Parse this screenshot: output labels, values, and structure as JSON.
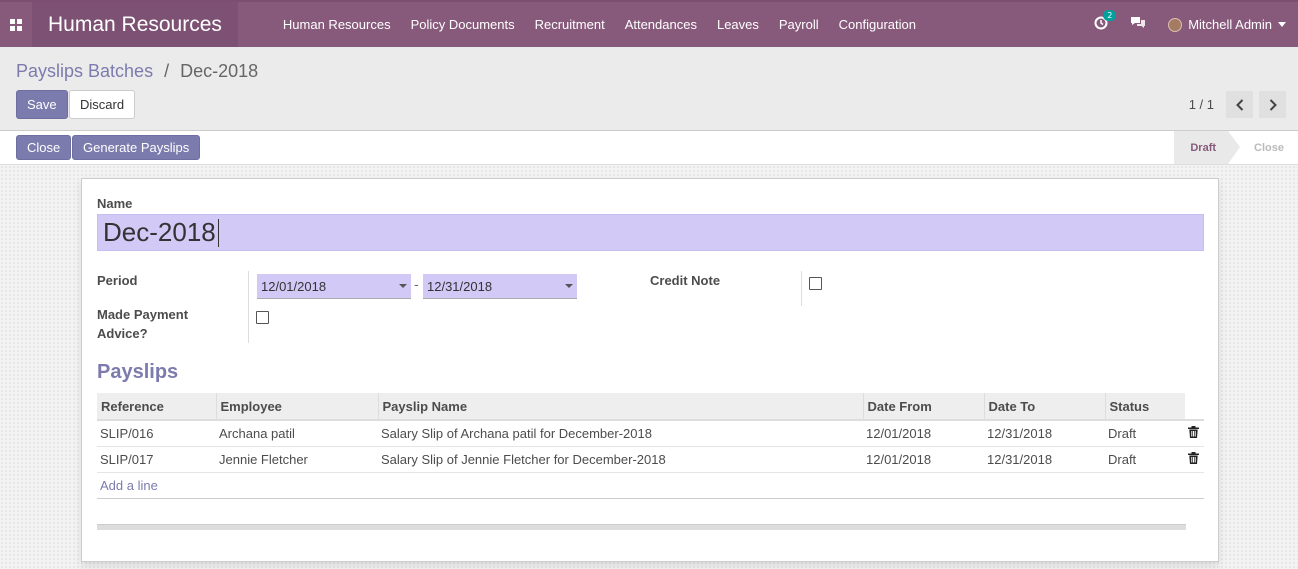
{
  "navbar": {
    "app_title": "Human Resources",
    "menu": [
      "Human Resources",
      "Policy Documents",
      "Recruitment",
      "Attendances",
      "Leaves",
      "Payroll",
      "Configuration"
    ],
    "activity_count": "2",
    "user_name": "Mitchell Admin"
  },
  "breadcrumb": {
    "parent": "Payslips Batches",
    "separator": "/",
    "current": "Dec-2018"
  },
  "buttons": {
    "save": "Save",
    "discard": "Discard",
    "close": "Close",
    "generate": "Generate Payslips"
  },
  "pager": {
    "value": "1 / 1"
  },
  "stages": {
    "draft": "Draft",
    "close": "Close",
    "current": "Draft"
  },
  "form": {
    "name_label": "Name",
    "name_value": "Dec-2018",
    "period_label": "Period",
    "date_from": "12/01/2018",
    "date_separator": "-",
    "date_to": "12/31/2018",
    "credit_note_label": "Credit Note",
    "credit_note_checked": false,
    "payment_advice_label_1": "Made Payment",
    "payment_advice_label_2": "Advice?",
    "payment_advice_checked": false
  },
  "payslips": {
    "title": "Payslips",
    "columns": [
      "Reference",
      "Employee",
      "Payslip Name",
      "Date From",
      "Date To",
      "Status"
    ],
    "rows": [
      [
        "SLIP/016",
        "Archana patil",
        "Salary Slip of Archana patil for December-2018",
        "12/01/2018",
        "12/31/2018",
        "Draft"
      ],
      [
        "SLIP/017",
        "Jennie Fletcher",
        "Salary Slip of Jennie Fletcher for December-2018",
        "12/01/2018",
        "12/31/2018",
        "Draft"
      ]
    ],
    "add_line": "Add a line"
  },
  "colors": {
    "navbar": "#875a7b",
    "primary": "#7c7bad",
    "input_bg": "#d2c9f7"
  }
}
